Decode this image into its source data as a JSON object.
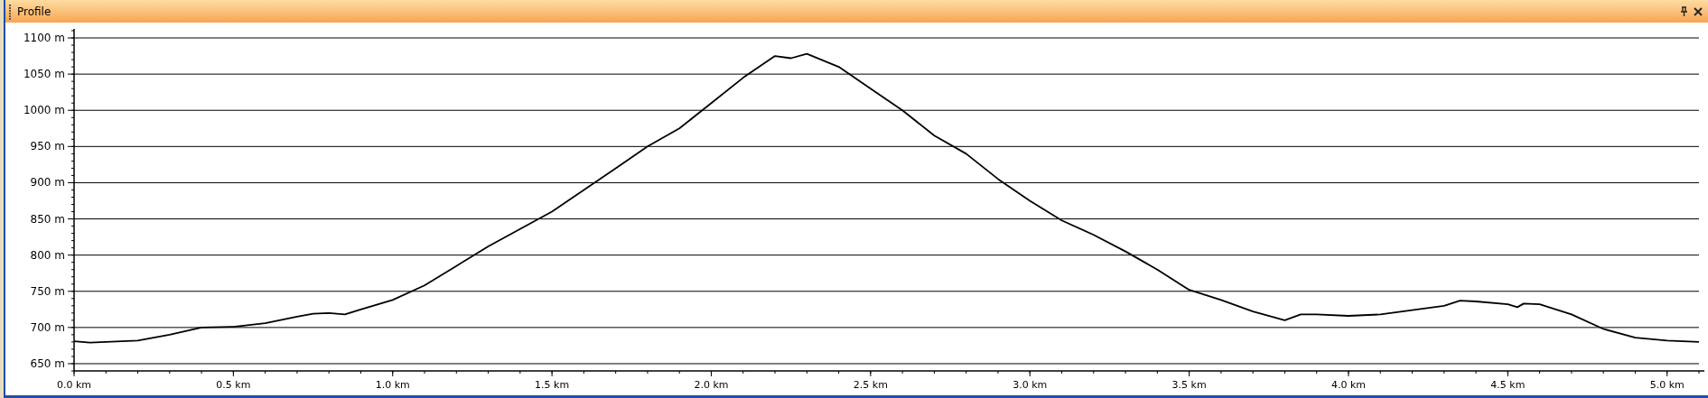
{
  "panel": {
    "title": "Profile"
  },
  "chart_data": {
    "type": "line",
    "grid": true,
    "xlim": [
      0,
      5.1
    ],
    "ylim": [
      640,
      1110
    ],
    "xticks": [
      {
        "value": 0,
        "label": "0.0 km"
      },
      {
        "value": 0.5,
        "label": "0.5 km"
      },
      {
        "value": 1,
        "label": "1.0 km"
      },
      {
        "value": 1.5,
        "label": "1.5 km"
      },
      {
        "value": 2,
        "label": "2.0 km"
      },
      {
        "value": 2.5,
        "label": "2.5 km"
      },
      {
        "value": 3,
        "label": "3.0 km"
      },
      {
        "value": 3.5,
        "label": "3.5 km"
      },
      {
        "value": 4,
        "label": "4.0 km"
      },
      {
        "value": 4.5,
        "label": "4.5 km"
      },
      {
        "value": 5,
        "label": "5.0 km"
      }
    ],
    "yticks": [
      {
        "value": 650,
        "label": "650 m"
      },
      {
        "value": 700,
        "label": "700 m"
      },
      {
        "value": 750,
        "label": "750 m"
      },
      {
        "value": 800,
        "label": "800 m"
      },
      {
        "value": 850,
        "label": "850 m"
      },
      {
        "value": 900,
        "label": "900 m"
      },
      {
        "value": 950,
        "label": "950 m"
      },
      {
        "value": 1000,
        "label": "1000 m"
      },
      {
        "value": 1050,
        "label": "1050 m"
      },
      {
        "value": 1100,
        "label": "1100 m"
      }
    ],
    "x": [
      0,
      0.05,
      0.1,
      0.2,
      0.3,
      0.4,
      0.5,
      0.6,
      0.7,
      0.75,
      0.8,
      0.85,
      0.9,
      1.0,
      1.1,
      1.2,
      1.3,
      1.4,
      1.5,
      1.6,
      1.7,
      1.8,
      1.9,
      2.0,
      2.1,
      2.2,
      2.25,
      2.3,
      2.4,
      2.5,
      2.6,
      2.7,
      2.8,
      2.9,
      3.0,
      3.1,
      3.2,
      3.3,
      3.4,
      3.5,
      3.6,
      3.7,
      3.8,
      3.85,
      3.9,
      4.0,
      4.1,
      4.2,
      4.3,
      4.35,
      4.4,
      4.5,
      4.53,
      4.55,
      4.6,
      4.7,
      4.8,
      4.9,
      5.0,
      5.1
    ],
    "series": [
      {
        "color": "#000000",
        "values": [
          681,
          679,
          680,
          682,
          690,
          700,
          701,
          706,
          715,
          719,
          720,
          718,
          725,
          738,
          758,
          785,
          812,
          836,
          860,
          890,
          920,
          950,
          975,
          1010,
          1045,
          1075,
          1072,
          1078,
          1060,
          1030,
          1000,
          965,
          940,
          905,
          875,
          848,
          828,
          805,
          780,
          752,
          738,
          722,
          710,
          718,
          718,
          716,
          718,
          724,
          730,
          737,
          736,
          732,
          728,
          733,
          732,
          718,
          698,
          686,
          682,
          680
        ]
      }
    ]
  }
}
